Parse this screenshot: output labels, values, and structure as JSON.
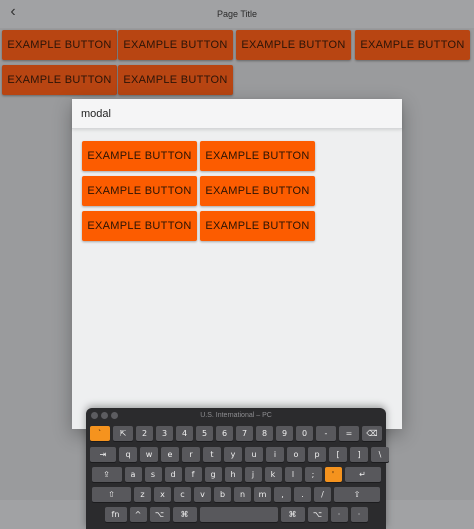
{
  "header": {
    "back_icon": "chevron-left-icon",
    "back_glyph": "‹",
    "title": "Page Title"
  },
  "background_buttons": [
    "EXAMPLE BUTTON",
    "EXAMPLE BUTTON",
    "EXAMPLE BUTTON",
    "EXAMPLE BUTTON",
    "EXAMPLE BUTTON",
    "EXAMPLE BUTTON"
  ],
  "modal": {
    "title": "modal",
    "buttons": [
      "EXAMPLE BUTTON",
      "EXAMPLE BUTTON",
      "EXAMPLE BUTTON",
      "EXAMPLE BUTTON",
      "EXAMPLE BUTTON",
      "EXAMPLE BUTTON"
    ]
  },
  "keyboard": {
    "title": "U.S. International – PC",
    "rows": [
      [
        "`",
        "⇱",
        "2",
        "3",
        "4",
        "5",
        "6",
        "7",
        "8",
        "9",
        "0",
        "-",
        "=",
        "⌫"
      ],
      [
        "⇥",
        "q",
        "w",
        "e",
        "r",
        "t",
        "y",
        "u",
        "i",
        "o",
        "p",
        "[",
        "]",
        "\\"
      ],
      [
        "⇪",
        "a",
        "s",
        "d",
        "f",
        "g",
        "h",
        "j",
        "k",
        "l",
        ";",
        "'",
        "↵"
      ],
      [
        "⇧",
        "z",
        "x",
        "c",
        "v",
        "b",
        "n",
        "m",
        ",",
        ".",
        "/",
        "⇧"
      ],
      [
        "fn",
        "^",
        "⌥",
        "⌘",
        "",
        "⌘",
        "⌥",
        "·",
        "·"
      ]
    ]
  },
  "colors": {
    "background": "#9a9b9d",
    "bg_button": "#b84512",
    "modal_button": "#fc5c00",
    "keyboard_accent": "#f5931e"
  }
}
